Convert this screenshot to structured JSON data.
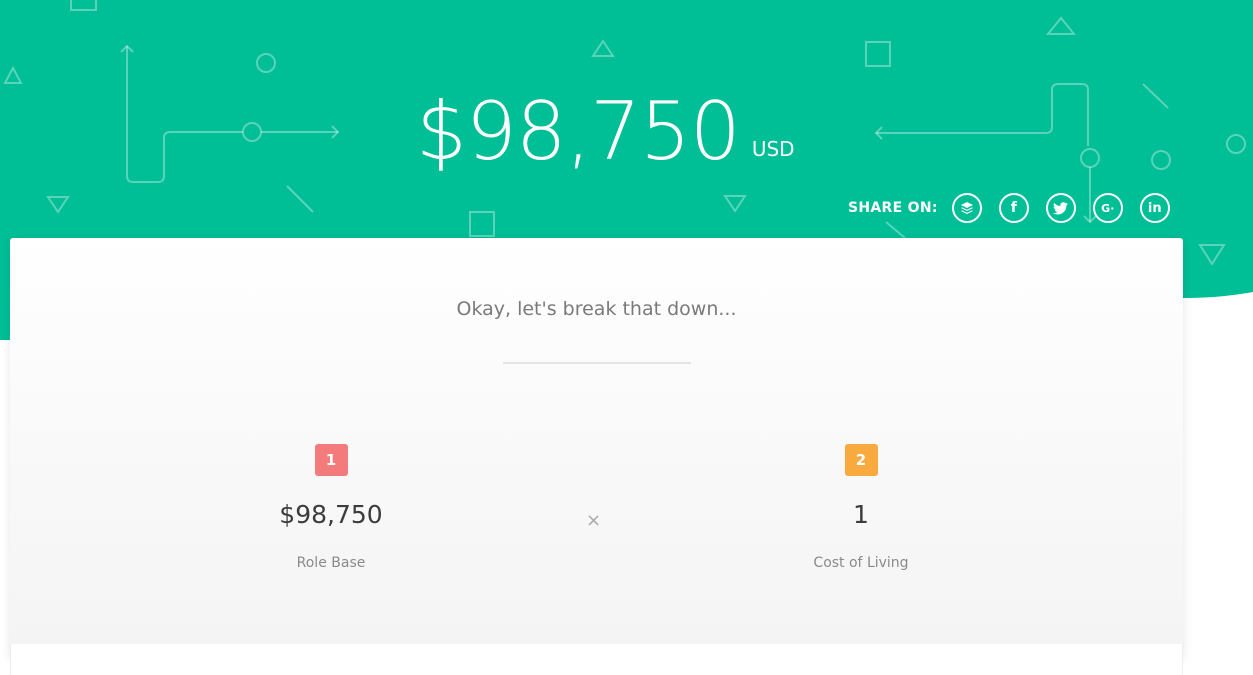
{
  "hero": {
    "salary_amount": "$98,750",
    "currency": "USD",
    "share_label": "SHARE ON:",
    "share_icons": [
      "buffer-icon",
      "facebook-icon",
      "twitter-icon",
      "google-plus-icon",
      "linkedin-icon"
    ],
    "background_color": "#00BE96",
    "share_icon_text": {
      "facebook": "f",
      "google_plus": "G·",
      "linkedin": "in"
    }
  },
  "breakdown": {
    "title": "Okay, let's break that down...",
    "factors": [
      {
        "number": "1",
        "value": "$98,750",
        "label": "Role Base",
        "badge_color": "#F47B7B"
      },
      {
        "number": "2",
        "value": "1",
        "label": "Cost of Living",
        "badge_color": "#F8AA3E"
      }
    ],
    "operator": "×"
  }
}
